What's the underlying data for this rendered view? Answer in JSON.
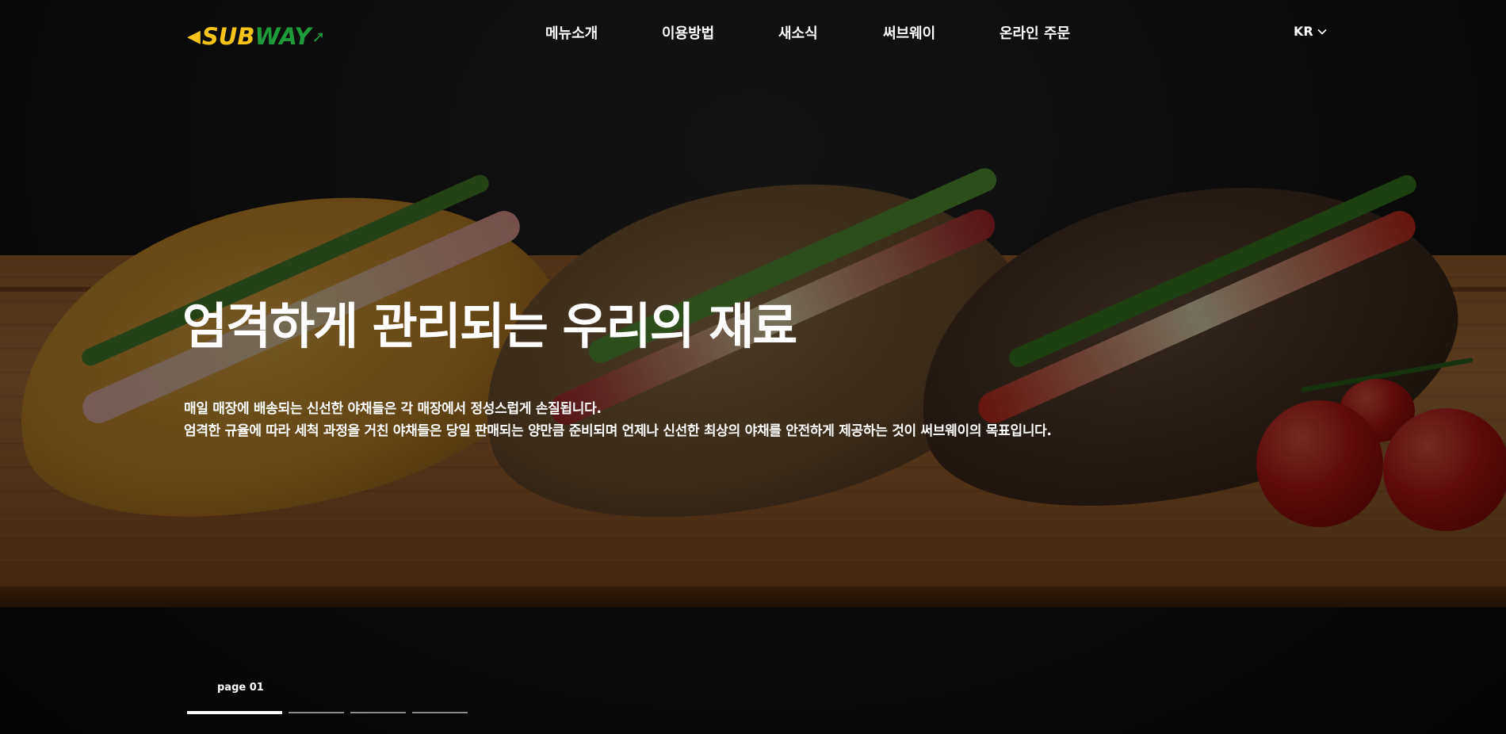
{
  "brand": {
    "logo_sub": "SUB",
    "logo_way": "WAY",
    "colors": {
      "yellow": "#f6c318",
      "green": "#1e9a3a"
    }
  },
  "nav": {
    "items": [
      {
        "label": "메뉴소개"
      },
      {
        "label": "이용방법"
      },
      {
        "label": "새소식"
      },
      {
        "label": "써브웨이"
      },
      {
        "label": "온라인 주문"
      }
    ],
    "language": {
      "label": "KR",
      "icon": "chevron-down-icon"
    }
  },
  "hero": {
    "headline": "엄격하게 관리되는 우리의 재료",
    "description": [
      "매일 매장에 배송되는 신선한 야채들은 각 매장에서 정성스럽게 손질됩니다.",
      "엄격한 규율에 따라 세척 과정을 거친 야채들은 당일 판매되는 양만큼 준비되며 언제나 신선한 최상의 야채를 안전하게 제공하는 것이 써브웨이의 목표입니다."
    ],
    "background_image": "sandwiches-on-wooden-board"
  },
  "slider": {
    "page_label": "page 01",
    "total_pages": 4,
    "active_index": 0
  }
}
